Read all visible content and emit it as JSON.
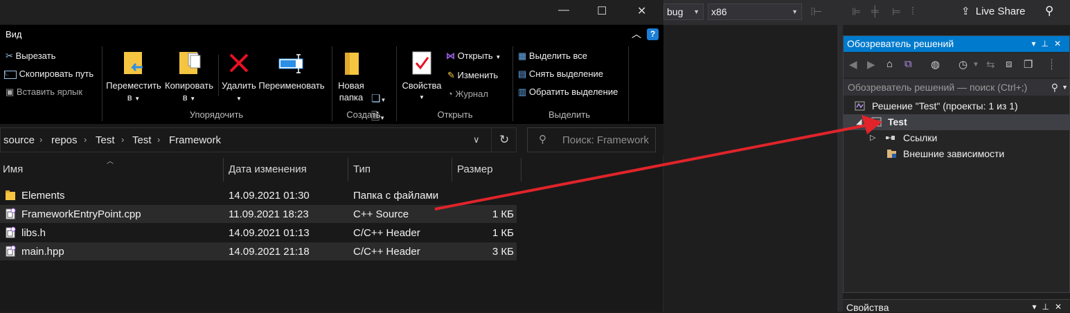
{
  "vs": {
    "config_combo": "bug",
    "platform_combo": "x86",
    "live_share": "Live Share",
    "solution_explorer": {
      "title": "Обозреватель решений",
      "search_placeholder": "Обозреватель решений — поиск (Ctrl+;)",
      "tree": [
        {
          "label": "Решение \"Test\" (проекты: 1 из 1)"
        },
        {
          "label": "Test"
        },
        {
          "label": "Ссылки"
        },
        {
          "label": "Внешние зависимости"
        }
      ]
    },
    "properties_title": "Свойства"
  },
  "explorer": {
    "ribbon_tab": "Вид",
    "ribbon": {
      "cut": "Вырезать",
      "copy_path": "Скопировать путь",
      "paste_shortcut": "Вставить ярлык",
      "move_to": "Переместить",
      "move_to_line2": "в",
      "copy_to": "Копировать",
      "copy_to_line2": "в",
      "delete": "Удалить",
      "rename": "Переименовать",
      "new_folder": "Новая",
      "new_folder_line2": "папка",
      "properties": "Свойства",
      "open": "Открыть",
      "edit": "Изменить",
      "history": "Журнал",
      "select_all": "Выделить все",
      "select_none": "Снять выделение",
      "invert_selection": "Обратить выделение",
      "group_organize": "Упорядочить",
      "group_new": "Создать",
      "group_open": "Открыть",
      "group_select": "Выделить"
    },
    "breadcrumb": [
      "source",
      "repos",
      "Test",
      "Test",
      "Framework"
    ],
    "search_placeholder": "Поиск: Framework",
    "columns": {
      "name": "Имя",
      "date": "Дата изменения",
      "type": "Тип",
      "size": "Размер"
    },
    "files": [
      {
        "name": "Elements",
        "date": "14.09.2021 01:30",
        "type": "Папка с файлами",
        "size": ""
      },
      {
        "name": "FrameworkEntryPoint.cpp",
        "date": "11.09.2021 18:23",
        "type": "C++ Source",
        "size": "1 КБ"
      },
      {
        "name": "libs.h",
        "date": "14.09.2021 01:13",
        "type": "C/C++ Header",
        "size": "1 КБ"
      },
      {
        "name": "main.hpp",
        "date": "14.09.2021 21:18",
        "type": "C/C++ Header",
        "size": "3 КБ"
      }
    ]
  },
  "colors": {
    "vs_accent": "#007acc",
    "arrow": "#e0242a",
    "folder": "#f5c542",
    "delete_red": "#e81123"
  }
}
